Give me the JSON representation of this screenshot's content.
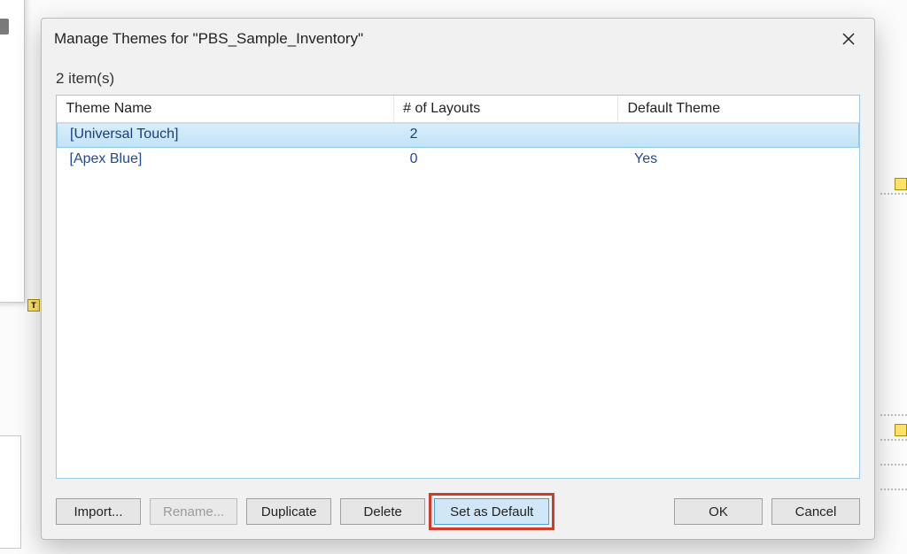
{
  "dialog": {
    "title": "Manage Themes for \"PBS_Sample_Inventory\"",
    "item_count": "2 item(s)"
  },
  "columns": {
    "name": "Theme Name",
    "layouts": "# of Layouts",
    "default": "Default Theme"
  },
  "rows": [
    {
      "name": "[Universal Touch]",
      "layouts": "2",
      "default": "",
      "selected": true
    },
    {
      "name": "[Apex Blue]",
      "layouts": "0",
      "default": "Yes",
      "selected": false
    }
  ],
  "buttons": {
    "import": "Import...",
    "rename": "Rename...",
    "duplicate": "Duplicate",
    "delete": "Delete",
    "set_default": "Set as Default",
    "ok": "OK",
    "cancel": "Cancel"
  },
  "bg": {
    "t_label": "T"
  }
}
